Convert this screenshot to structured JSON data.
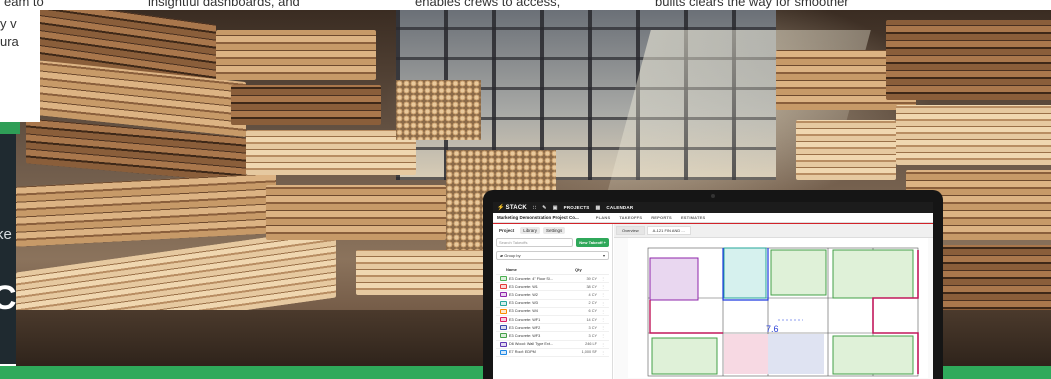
{
  "top_text": {
    "left_fragment": "eam to",
    "col2": "insightful dashboards, and",
    "col3": "enables crews to access,",
    "col4": "builts clears the way for smoother"
  },
  "left_remnant": {
    "line1": "y v",
    "line2": "ura",
    "dark_text1": "ke",
    "dark_text2": "C"
  },
  "app": {
    "logo": "STACK",
    "nav": [
      "PROJECTS",
      "CALENDAR"
    ],
    "project_name": "Marketing Demonstration Project Co...",
    "sub_nav": [
      "PLANS",
      "TAKEOFFS",
      "REPORTS",
      "ESTIMATES"
    ],
    "left_tabs": [
      "Project",
      "Library",
      "Settings"
    ],
    "search_placeholder": "Search Takeoffs",
    "new_takeoff_label": "New Takeoff +",
    "group_by_label": "Group by",
    "table_headers": {
      "name": "Name",
      "qty": "Qty"
    },
    "takeoffs": [
      {
        "name": "E3 Concrete: 4\" Floor Sl...",
        "qty": "39 CY",
        "color": "#4caf50"
      },
      {
        "name": "E3 Concrete: W1",
        "qty": "38 CY",
        "color": "#e53935"
      },
      {
        "name": "E3 Concrete: W2",
        "qty": "4 CY",
        "color": "#8e24aa"
      },
      {
        "name": "E3 Concrete: W3",
        "qty": "2 CY",
        "color": "#26a69a"
      },
      {
        "name": "E3 Concrete: W4",
        "qty": "6 CY",
        "color": "#fb8c00"
      },
      {
        "name": "E3 Concrete: WF1",
        "qty": "14 CY",
        "color": "#d81b60"
      },
      {
        "name": "E3 Concrete: WF2",
        "qty": "3 CY",
        "color": "#3949ab"
      },
      {
        "name": "E3 Concrete: WF3",
        "qty": "3 CY",
        "color": "#43a047"
      },
      {
        "name": "D6 Wood: Wall Type Ext...",
        "qty": "246 LF",
        "color": "#5e35b1"
      },
      {
        "name": "E7 Roof: EDPM",
        "qty": "1,000 SF",
        "color": "#1e88e5"
      }
    ],
    "plan_tabs": [
      "Overview",
      "A-121 FIN AND ..."
    ],
    "measurement_label": "7.6"
  },
  "colors": {
    "accent_green": "#2faa5b",
    "app_bar": "#1c1c1c",
    "accent_red": "#d2232a"
  }
}
